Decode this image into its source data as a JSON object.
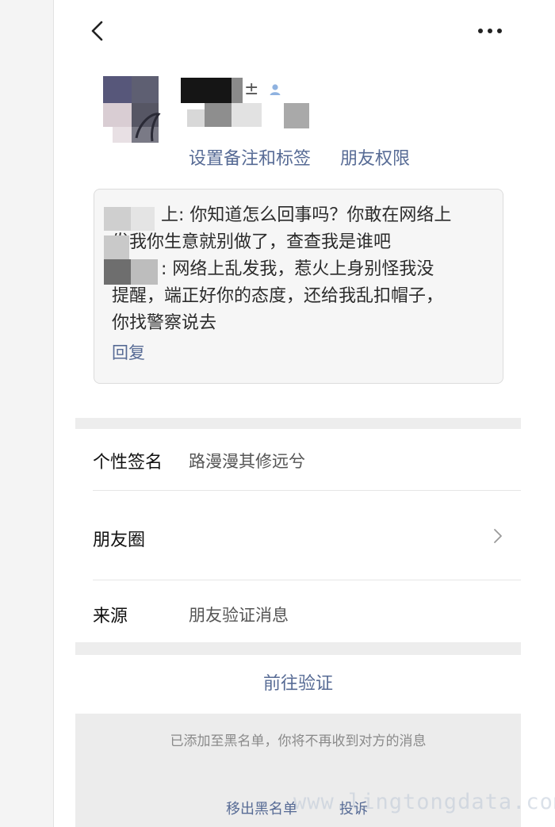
{
  "nav": {
    "back_icon": "chevron-left-icon",
    "more_icon": "more-horizontal-icon"
  },
  "profile": {
    "name_glyph": "±",
    "gender_icon": "person-icon",
    "actions": {
      "set_remark": "设置备注和标签",
      "friend_permission": "朋友权限"
    }
  },
  "message": {
    "lines": [
      "上: 你知道怎么回事吗？你敢在网络上",
      "发我你生意就别做了，查查我是谁吧",
      ": 网络上乱发我，惹火上身别怪我没",
      "提醒，端正好你的态度，还给我乱扣帽子，",
      "你找警察说去"
    ],
    "reply": "回复"
  },
  "info": {
    "signature": {
      "label": "个性签名",
      "value": "路漫漫其修远兮"
    },
    "moments": {
      "label": "朋友圈"
    },
    "source": {
      "label": "来源",
      "value": "朋友验证消息"
    }
  },
  "verify": "前往验证",
  "blacklist": {
    "notice": "已添加至黑名单，你将不再收到对方的消息",
    "remove": "移出黑名单",
    "report": "投诉"
  },
  "watermark": "www.lingtongdata.com",
  "colors": {
    "link": "#576b95",
    "background": "#ffffff",
    "band": "#ededed"
  }
}
